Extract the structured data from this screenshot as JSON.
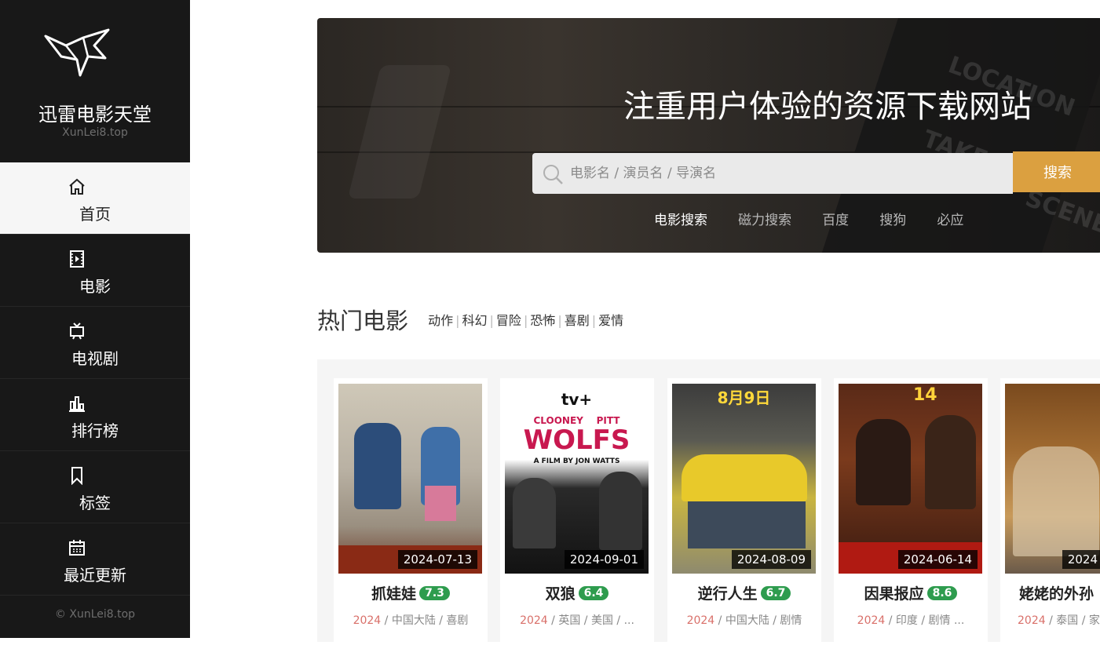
{
  "brand": {
    "name": "迅雷电影天堂",
    "domain": "XunLei8.top"
  },
  "nav": [
    {
      "label": "首页",
      "icon": "home-icon",
      "active": true
    },
    {
      "label": "电影",
      "icon": "film-icon"
    },
    {
      "label": "电视剧",
      "icon": "tv-icon"
    },
    {
      "label": "排行榜",
      "icon": "bar-chart-icon"
    },
    {
      "label": "标签",
      "icon": "bookmark-icon"
    },
    {
      "label": "最近更新",
      "icon": "calendar-icon"
    }
  ],
  "copyright": "© XunLei8.top",
  "hero": {
    "title": "注重用户体验的资源下载网站",
    "search_placeholder": "电影名 / 演员名 / 导演名",
    "search_button": "搜索",
    "engines": [
      "电影搜索",
      "磁力搜索",
      "百度",
      "搜狗",
      "必应"
    ]
  },
  "hot": {
    "title": "热门电影",
    "categories": [
      "动作",
      "科幻",
      "冒险",
      "恐怖",
      "喜剧",
      "爱情"
    ]
  },
  "movies": [
    {
      "title": "抓娃娃",
      "score": "7.3",
      "date": "2024-07-13",
      "year": "2024",
      "meta": " / 中国大陆 / 喜剧"
    },
    {
      "title": "双狼",
      "score": "6.4",
      "date": "2024-09-01",
      "year": "2024",
      "meta": " / 英国 / 美国 / ..."
    },
    {
      "title": "逆行人生",
      "score": "6.7",
      "date": "2024-08-09",
      "year": "2024",
      "meta": " / 中国大陆 / 剧情"
    },
    {
      "title": "因果报应",
      "score": "8.6",
      "date": "2024-06-14",
      "year": "2024",
      "meta": " / 印度 / 剧情 ..."
    },
    {
      "title": "姥姥的外孙",
      "score": "",
      "date": "2024",
      "year": "2024",
      "meta": " / 泰国 / 家..."
    }
  ],
  "poster_text": {
    "wolfs_brand": "tv+",
    "wolfs_actors": "CLOONEY    PITT",
    "wolfs_title": "WOLFS",
    "wolfs_credit": "A FILM BY JON WATTS",
    "nixing_date": "8月9日",
    "yinguo_num": "14"
  },
  "colors": {
    "sidebar": "#181818",
    "accent": "#dba040",
    "score": "#2e9c4e",
    "year": "#d9706a"
  }
}
